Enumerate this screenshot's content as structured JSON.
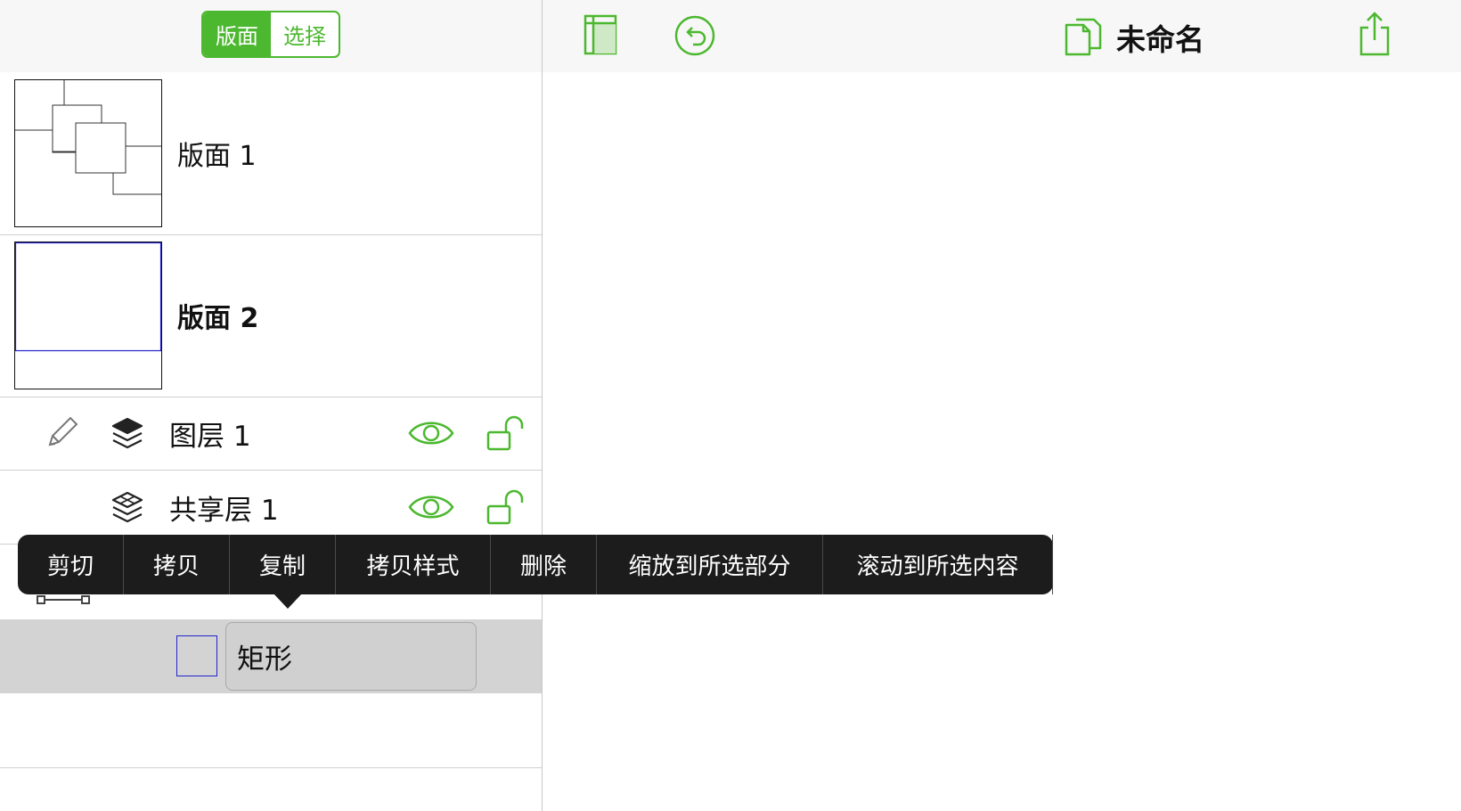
{
  "segmented": {
    "canvases_label": "版面",
    "select_label": "选择",
    "active": "canvases"
  },
  "canvases": [
    {
      "label": "版面 1",
      "bold": false
    },
    {
      "label": "版面 2",
      "bold": true
    }
  ],
  "layers": [
    {
      "label": "图层 1",
      "editable": true
    },
    {
      "label": "共享层 1",
      "editable": false
    }
  ],
  "selected_object": {
    "name": "矩形"
  },
  "toolbar": {
    "title": "未命名"
  },
  "context_menu": {
    "items": [
      "剪切",
      "拷贝",
      "复制",
      "拷贝样式",
      "删除",
      "缩放到所选部分",
      "滚动到所选内容"
    ]
  },
  "colors": {
    "accent": "#4cb82f",
    "menu_bg": "#1c1c1c",
    "selection_bg": "#d3d3d3"
  },
  "icons": [
    "pencil-icon",
    "layers-icon",
    "eye-icon",
    "unlock-icon",
    "sidebar-toggle-icon",
    "undo-icon",
    "documents-icon",
    "share-icon",
    "line-tool-icon"
  ]
}
